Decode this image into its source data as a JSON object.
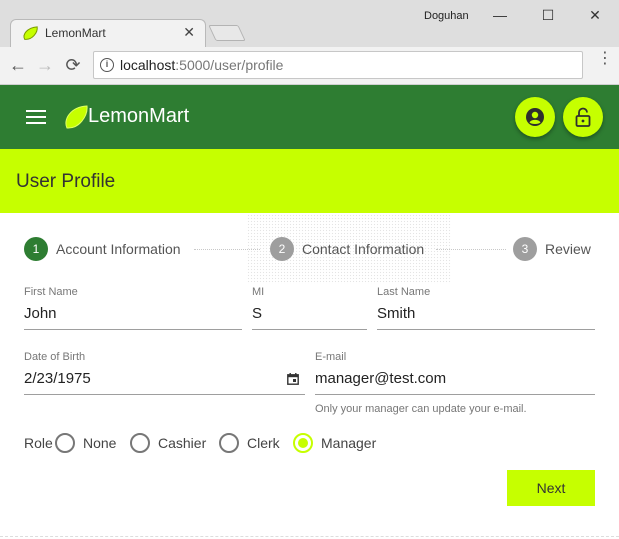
{
  "browser": {
    "tab_title": "LemonMart",
    "tab_close": "✕",
    "user_name": "Doguhan",
    "minimize": "—",
    "maximize": "☐",
    "close": "✕",
    "back": "←",
    "forward": "→",
    "reload": "⟳",
    "info": "i",
    "url_host": "localhost",
    "url_path": ":5000/user/profile",
    "menu": "⋮"
  },
  "app": {
    "title": "LemonMart",
    "brand_color": "#2e7d32",
    "accent_color": "#c6ff00",
    "icons": [
      "menu-icon",
      "lemon-logo",
      "account-circle-icon",
      "lock-open-icon"
    ]
  },
  "page": {
    "title": "User Profile"
  },
  "stepper": {
    "steps": [
      {
        "number": "1",
        "label": "Account Information",
        "active": true
      },
      {
        "number": "2",
        "label": "Contact Information",
        "active": false
      },
      {
        "number": "3",
        "label": "Review",
        "active": false
      }
    ]
  },
  "form": {
    "first_name": {
      "label": "First Name",
      "value": "John"
    },
    "mi": {
      "label": "MI",
      "value": "S"
    },
    "last_name": {
      "label": "Last Name",
      "value": "Smith"
    },
    "dob": {
      "label": "Date of Birth",
      "value": "2/23/1975"
    },
    "email": {
      "label": "E-mail",
      "value": "manager@test.com",
      "hint": "Only your manager can update your e-mail."
    },
    "role": {
      "label": "Role",
      "options": [
        "None",
        "Cashier",
        "Clerk",
        "Manager"
      ],
      "selected": "Manager"
    },
    "next_label": "Next"
  }
}
